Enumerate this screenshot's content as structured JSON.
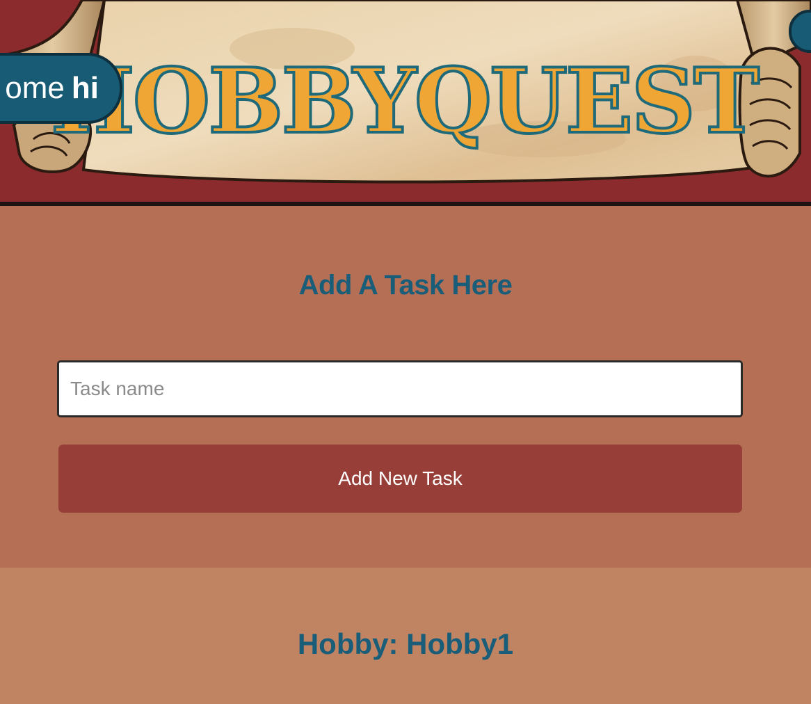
{
  "header": {
    "welcome_text": "ome",
    "username": "hi",
    "logo_text": "HOBBYQUEST",
    "colors": {
      "banner_background": "#8c2b2d",
      "logo_fill": "#f0a634",
      "logo_outline": "#1e6a7a",
      "pill": "#185b75"
    }
  },
  "add_task": {
    "heading": "Add A Task Here",
    "input_placeholder": "Task name",
    "input_value": "",
    "button_label": "Add New Task"
  },
  "hobby": {
    "heading": "Hobby: Hobby1"
  }
}
